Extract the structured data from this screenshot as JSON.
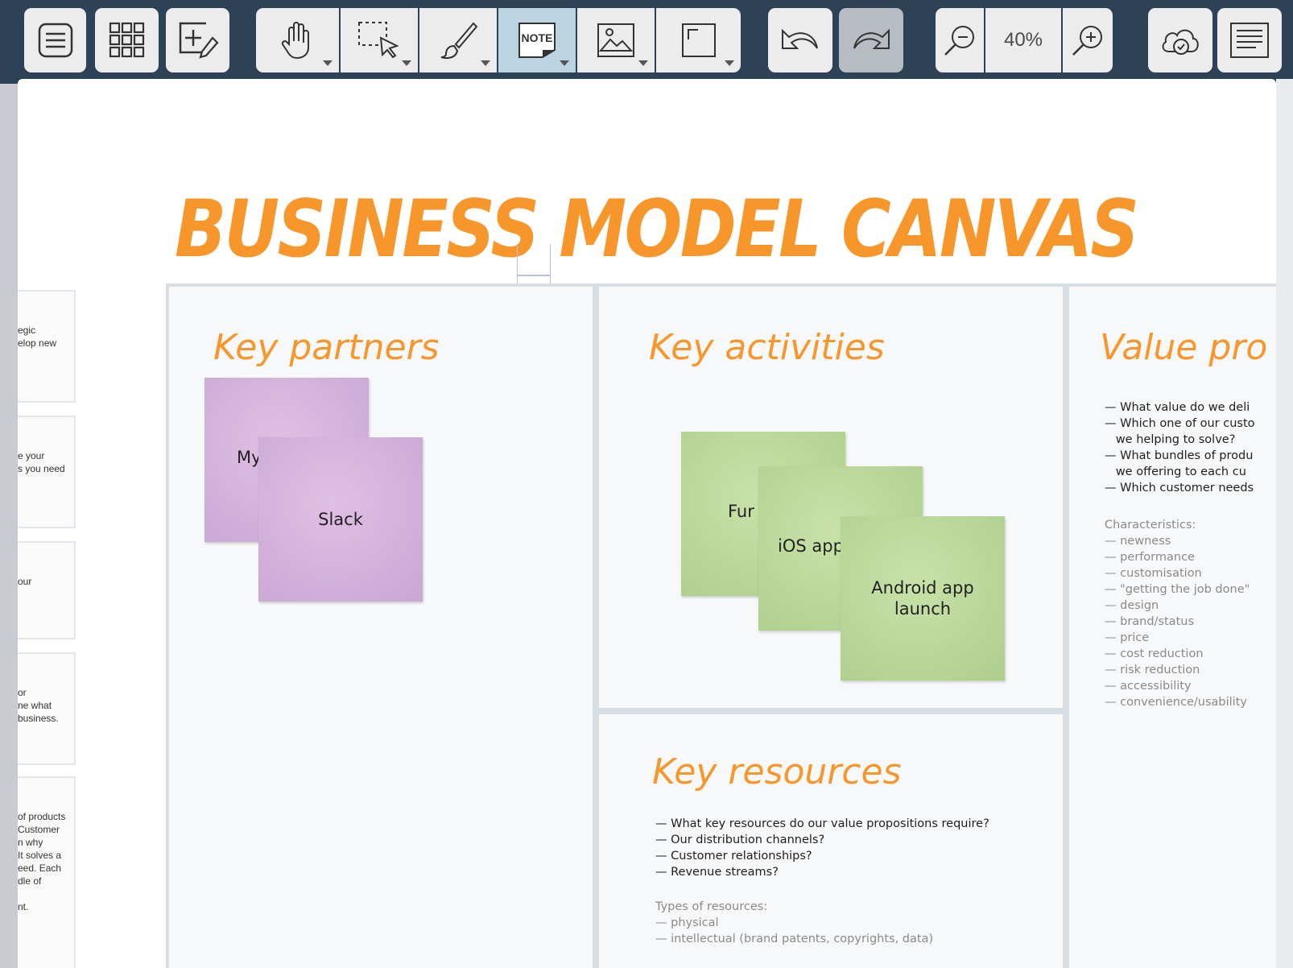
{
  "toolbar": {
    "zoom_level": "40%",
    "note_tool_label": "NOTE",
    "colors": {
      "bar": "#2e4257",
      "button": "#ececec",
      "active": "#bcd3e2"
    },
    "icons": [
      "menu-icon",
      "grid-icon",
      "add-board-icon",
      "hand-icon",
      "select-icon",
      "brush-icon",
      "note-icon",
      "image-icon",
      "frame-icon",
      "undo-icon",
      "redo-icon",
      "zoom-out-icon",
      "zoom-in-icon",
      "cloud-sync-icon",
      "outline-icon"
    ]
  },
  "canvas": {
    "title": "BUSINESS MODEL CANVAS",
    "accent_color": "#f7962b",
    "side_cards": [
      {
        "lines": [
          "egic",
          "elop new"
        ]
      },
      {
        "lines": [
          "e your",
          "s you need"
        ]
      },
      {
        "lines": [
          "our"
        ]
      },
      {
        "lines": [
          "or",
          "ne what",
          "business."
        ]
      },
      {
        "lines": [
          "of products",
          "Customer",
          "n why",
          "It solves a",
          "eed. Each",
          "dle of",
          "",
          "nt."
        ]
      }
    ],
    "key_partners": {
      "heading": "Key partners",
      "notes": [
        {
          "text": "My",
          "color": "purple"
        },
        {
          "text": "Slack",
          "color": "purple"
        }
      ]
    },
    "key_activities": {
      "heading": "Key activities",
      "notes": [
        {
          "text": "Fur",
          "color": "green"
        },
        {
          "text": "iOS app",
          "color": "green"
        },
        {
          "text": "Android app launch",
          "color": "green"
        }
      ]
    },
    "key_resources": {
      "heading": "Key resources",
      "questions": [
        "— What key resources do our value propositions require?",
        "— Our distribution channels?",
        "— Customer relationships?",
        "— Revenue streams?"
      ],
      "types_label": "Types of resources:",
      "types": [
        "— physical",
        "— intellectual (brand patents, copyrights, data)"
      ]
    },
    "value_propositions": {
      "heading": "Value pro",
      "questions": [
        "— What value do we deli",
        "— Which one of our custo",
        "   we helping to solve?",
        "— What bundles of produ",
        "   we offering to each cu",
        "— Which customer needs"
      ],
      "characteristics_label": "Characteristics:",
      "characteristics": [
        "— newness",
        "— performance",
        "— customisation",
        "— \"getting the job done\"",
        "— design",
        "— brand/status",
        "— price",
        "— cost reduction",
        "— risk reduction",
        "— accessibility",
        "— convenience/usability"
      ]
    }
  }
}
